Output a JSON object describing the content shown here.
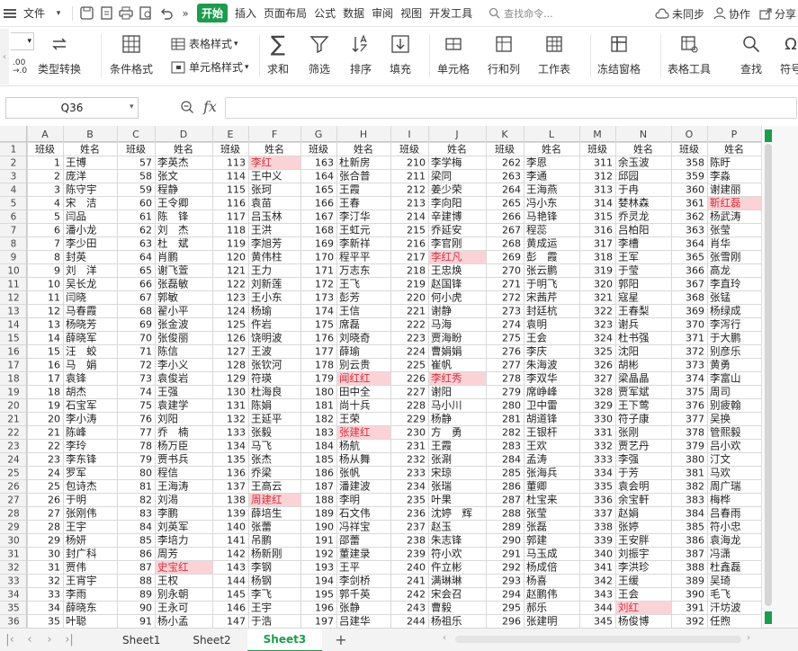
{
  "menu": {
    "file": "文件",
    "start": "开始",
    "items": [
      "插入",
      "页面布局",
      "公式",
      "数据",
      "审阅",
      "视图",
      "开发工具"
    ],
    "search": "查找命令...",
    "sync": "未同步",
    "collab": "协作",
    "share": "分享"
  },
  "ribbon": {
    "type_convert": "类型转换",
    "cond_format": "条件格式",
    "table_style": "表格样式",
    "cell_style": "单元格样式",
    "sum": "求和",
    "filter": "筛选",
    "sort": "排序",
    "fill": "填充",
    "cell": "单元格",
    "rowcol": "行和列",
    "sheet": "工作表",
    "freeze": "冻结窗格",
    "table_tools": "表格工具",
    "find": "查找",
    "symbol": "符号"
  },
  "formula": {
    "namebox": "Q36",
    "fx": "fx"
  },
  "columns": [
    "A",
    "B",
    "C",
    "D",
    "E",
    "F",
    "G",
    "H",
    "I",
    "J",
    "K",
    "L",
    "M",
    "N",
    "O",
    "P"
  ],
  "header": [
    "班级",
    "姓名",
    "班级",
    "姓名",
    "班级",
    "姓名",
    "班级",
    "姓名",
    "班级",
    "姓名",
    "班级",
    "姓名",
    "班级",
    "姓名",
    "班级",
    "姓名"
  ],
  "col1": {
    "nums": [
      "1",
      "2",
      "3",
      "4",
      "5",
      "6",
      "7",
      "8",
      "9",
      "10",
      "11",
      "12",
      "13",
      "14",
      "15",
      "16",
      "17",
      "18",
      "19",
      "20",
      "21",
      "22",
      "23",
      "24",
      "25",
      "26",
      "27",
      "28",
      "29",
      "30",
      "31",
      "32",
      "33",
      "34",
      "35"
    ],
    "names": [
      "王博",
      "庞洋",
      "陈守宇",
      "宋　洁",
      "闫品",
      "潘小龙",
      "李少田",
      "封英",
      "刘　洋",
      "吴长龙",
      "闫晓",
      "马春霞",
      "杨晓芳",
      "薛晓军",
      "汪　蛟",
      "马　娟",
      "袁锋",
      "胡杰",
      "石宝军",
      "李小涛",
      "陈峰",
      "李玲",
      "李东锋",
      "罗军",
      "包诗杰",
      "于明",
      "张刚伟",
      "王宇",
      "杨妍",
      "封广科",
      "贾伟",
      "王宵宇",
      "李雨",
      "薛晓东",
      "叶聪"
    ]
  },
  "col2": {
    "nums": [
      "57",
      "58",
      "59",
      "60",
      "61",
      "62",
      "63",
      "64",
      "65",
      "66",
      "67",
      "68",
      "69",
      "70",
      "71",
      "72",
      "73",
      "74",
      "75",
      "76",
      "77",
      "78",
      "79",
      "80",
      "81",
      "82",
      "83",
      "84",
      "85",
      "86",
      "87",
      "88",
      "89",
      "90",
      "91"
    ],
    "names": [
      "李英杰",
      "张文",
      "程静",
      "王令卿",
      "陈　锋",
      "刘　杰",
      "杜　斌",
      "肖鹏",
      "谢飞萱",
      "张磊敏",
      "郭敏",
      "翟小平",
      "张金波",
      "张俊丽",
      "陈信",
      "李小义",
      "袁俊岩",
      "王强",
      "袁建学",
      "刘阳",
      "乔　楠",
      "杨万臣",
      "贾书兵",
      "程信",
      "王海涛",
      "刘渴",
      "李鹏",
      "刘英军",
      "李培力",
      "周芳",
      "史宝红",
      "王权",
      "别永朝",
      "王永可",
      "杨小孟"
    ]
  },
  "col3": {
    "nums": [
      "113",
      "114",
      "115",
      "116",
      "117",
      "118",
      "119",
      "120",
      "121",
      "122",
      "123",
      "124",
      "125",
      "126",
      "127",
      "128",
      "129",
      "130",
      "131",
      "132",
      "133",
      "134",
      "135",
      "136",
      "137",
      "138",
      "139",
      "140",
      "141",
      "142",
      "143",
      "144",
      "145",
      "146",
      "147"
    ],
    "names": [
      "李红",
      "王中义",
      "张珂",
      "袁苗",
      "吕玉林",
      "王洪",
      "李旭芳",
      "黄伟柱",
      "王力",
      "刘新莲",
      "王小东",
      "杨瑜",
      "仵岩",
      "饶明波",
      "王波",
      "张钦河",
      "符瑛",
      "杜海良",
      "陈娟",
      "王延平",
      "张毅",
      "马飞",
      "张杰",
      "乔梁",
      "王高云",
      "周建红",
      "薛培生",
      "张蕾",
      "吊鹏",
      "杨新刚",
      "李钢",
      "杨钢",
      "李飞",
      "王宇",
      "于浩"
    ]
  },
  "col4": {
    "nums": [
      "163",
      "164",
      "165",
      "166",
      "167",
      "168",
      "169",
      "170",
      "171",
      "172",
      "173",
      "174",
      "175",
      "176",
      "177",
      "178",
      "179",
      "180",
      "181",
      "182",
      "183",
      "184",
      "185",
      "186",
      "187",
      "188",
      "189",
      "190",
      "191",
      "192",
      "193",
      "194",
      "195",
      "196",
      "197"
    ],
    "names": [
      "杜新房",
      "张合普",
      "王霞",
      "王春",
      "李汀华",
      "王虹元",
      "李新祥",
      "程平平",
      "万志东",
      "王飞",
      "彭芳",
      "王信",
      "席磊",
      "刘晓奇",
      "薛瑜",
      "别云贵",
      "闻红红",
      "田中全",
      "尚十兵",
      "王荣",
      "张建红",
      "杨航",
      "杨从舞",
      "张帆",
      "潘建波",
      "李明",
      "石文伟",
      "冯祥宝",
      "邵蕾",
      "董建录",
      "王平",
      "李剑桥",
      "郭千英",
      "张静",
      "吕建华"
    ]
  },
  "col5": {
    "nums": [
      "210",
      "211",
      "212",
      "213",
      "214",
      "215",
      "216",
      "217",
      "218",
      "219",
      "220",
      "221",
      "222",
      "223",
      "224",
      "225",
      "226",
      "227",
      "228",
      "229",
      "230",
      "231",
      "232",
      "233",
      "234",
      "235",
      "236",
      "237",
      "238",
      "239",
      "240",
      "241",
      "242",
      "243",
      "244"
    ],
    "names": [
      "李学梅",
      "梁同",
      "姜少荣",
      "李向阳",
      "辛建博",
      "乔延安",
      "李官刚",
      "李红凡",
      "王忠焕",
      "赵国锋",
      "何小虎",
      "谢静",
      "马海",
      "贾海盼",
      "曹娟娟",
      "崔帆",
      "李红秀",
      "谢阳",
      "马小川",
      "杨静",
      "方　勇",
      "王霞",
      "张涮",
      "宋琼",
      "张瑞",
      "叶果",
      "沈婷　辉",
      "赵玉",
      "朱志锋",
      "符小欢",
      "仵立彬",
      "满琳琳",
      "宋会召",
      "曹毅",
      "杨祖乐"
    ]
  },
  "col6": {
    "nums": [
      "262",
      "263",
      "264",
      "265",
      "266",
      "267",
      "268",
      "269",
      "270",
      "271",
      "272",
      "273",
      "274",
      "275",
      "276",
      "277",
      "278",
      "279",
      "280",
      "281",
      "282",
      "283",
      "284",
      "285",
      "286",
      "287",
      "288",
      "289",
      "290",
      "291",
      "292",
      "293",
      "294",
      "295",
      "296"
    ],
    "names": [
      "李恩",
      "李通",
      "王海燕",
      "冯小东",
      "马艳锋",
      "程蕊",
      "黄成运",
      "彭　霞",
      "张云鹏",
      "于明飞",
      "宋茜芹",
      "封廷杭",
      "袁明",
      "王会",
      "李庆",
      "朱海波",
      "李双华",
      "席峥峰",
      "卫中雷",
      "胡道锋",
      "王银杆",
      "王欢",
      "孟涛",
      "张海兵",
      "董卿",
      "杜宝来",
      "张莹",
      "张磊",
      "郭建",
      "马玉成",
      "杨成倍",
      "杨喜",
      "赵鹏伟",
      "郝乐",
      "张建明"
    ]
  },
  "col7": {
    "nums": [
      "311",
      "312",
      "313",
      "314",
      "315",
      "316",
      "317",
      "318",
      "319",
      "320",
      "321",
      "322",
      "323",
      "324",
      "325",
      "326",
      "327",
      "328",
      "329",
      "330",
      "331",
      "332",
      "333",
      "334",
      "335",
      "336",
      "337",
      "338",
      "339",
      "340",
      "341",
      "342",
      "343",
      "344",
      "345"
    ],
    "names": [
      "余玉波",
      "邱园",
      "于冉",
      "婪林森",
      "乔灵龙",
      "吕柏阳",
      "李槽",
      "王军",
      "于莹",
      "郭阳",
      "寇星",
      "王春梨",
      "谢兵",
      "杜书强",
      "沈阳",
      "胡彬",
      "梁晶晶",
      "贾军斌",
      "王下莺",
      "符子康",
      "张刚",
      "贾艺丹",
      "李强",
      "于芳",
      "袁会明",
      "余宝軒",
      "赵娟",
      "张婷",
      "王安胖",
      "刘振宇",
      "李洪珍",
      "王缓",
      "王会",
      "刘红",
      "杨俊博"
    ]
  },
  "col8": {
    "nums": [
      "358",
      "359",
      "360",
      "361",
      "362",
      "363",
      "364",
      "365",
      "366",
      "367",
      "368",
      "369",
      "370",
      "371",
      "372",
      "373",
      "374",
      "375",
      "376",
      "377",
      "378",
      "379",
      "380",
      "381",
      "382",
      "383",
      "384",
      "385",
      "386",
      "387",
      "388",
      "389",
      "390",
      "391",
      "392"
    ],
    "names": [
      "陈盱",
      "李淼",
      "谢建丽",
      "靳红磊",
      "杨武涛",
      "张莹",
      "肖华",
      "张雪刚",
      "高龙",
      "李直玲",
      "张锰",
      "杨绿成",
      "李泻行",
      "于大鹏",
      "别彦乐",
      "黄勇",
      "李富山",
      "周司",
      "别疲翰",
      "吴换",
      "管熙毅",
      "吕小欢",
      "汀文",
      "马欢",
      "周广瑞",
      "梅桦",
      "吕春雨",
      "符小忠",
      "袁海龙",
      "冯潇",
      "杜鑫磊",
      "吴琦",
      "毛飞",
      "汗坊波",
      "任煦"
    ]
  },
  "highlights": [
    "F2",
    "J9",
    "H18",
    "J18",
    "H22",
    "F27",
    "D32",
    "N35",
    "P5"
  ],
  "tabs": [
    "Sheet1",
    "Sheet2",
    "Sheet3"
  ],
  "active_tab": "Sheet3",
  "colors": {
    "accent": "#1e9b4f",
    "highlight": "#fbd3d7",
    "highlight_text": "#d9323e",
    "header_bg": "#f3f3f3",
    "gridline": "#d9d9d9"
  }
}
